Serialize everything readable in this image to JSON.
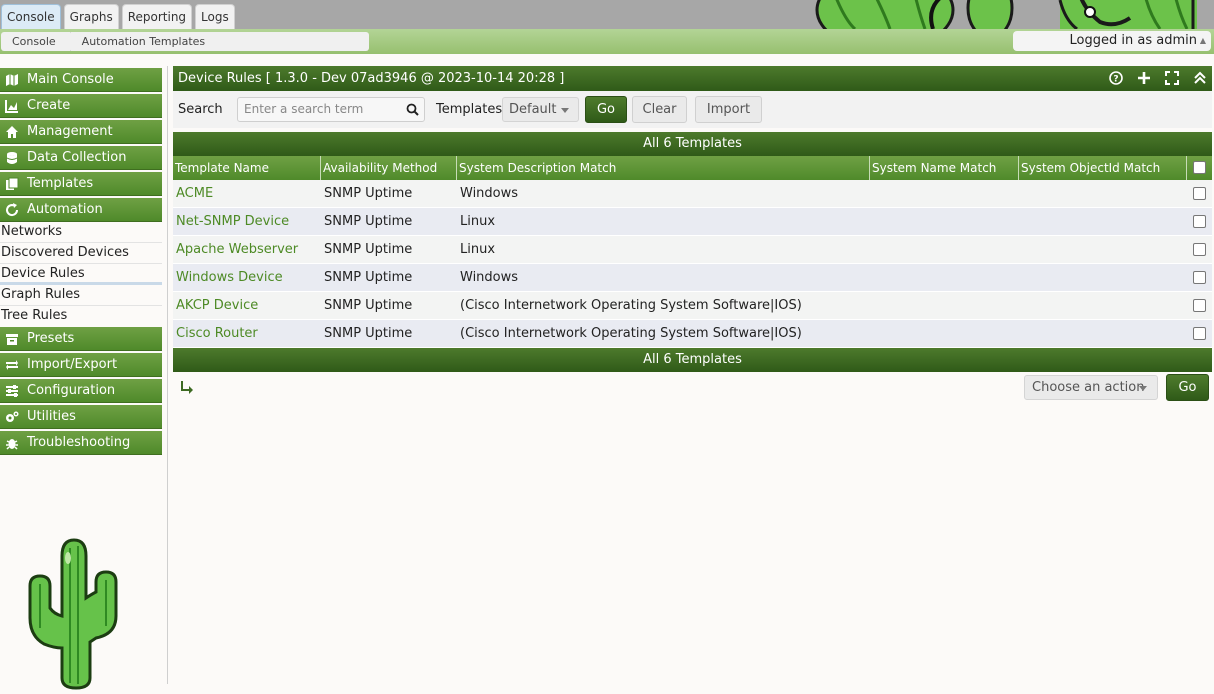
{
  "top_tabs": [
    {
      "label": "Console",
      "active": true
    },
    {
      "label": "Graphs",
      "active": false
    },
    {
      "label": "Reporting",
      "active": false
    },
    {
      "label": "Logs",
      "active": false
    }
  ],
  "breadcrumb": [
    "Console",
    "Automation Templates"
  ],
  "user": {
    "label": "Logged in as admin"
  },
  "sidebar": {
    "heads_top": [
      {
        "label": "Main Console",
        "icon": "map-icon"
      },
      {
        "label": "Create",
        "icon": "chart-icon"
      },
      {
        "label": "Management",
        "icon": "home-icon"
      },
      {
        "label": "Data Collection",
        "icon": "database-icon"
      },
      {
        "label": "Templates",
        "icon": "copy-icon"
      },
      {
        "label": "Automation",
        "icon": "refresh-icon"
      }
    ],
    "automation_items": [
      {
        "label": "Networks",
        "selected": false
      },
      {
        "label": "Discovered Devices",
        "selected": false
      },
      {
        "label": "Device Rules",
        "selected": true
      },
      {
        "label": "Graph Rules",
        "selected": false
      },
      {
        "label": "Tree Rules",
        "selected": false
      }
    ],
    "heads_bottom": [
      {
        "label": "Presets",
        "icon": "archive-icon"
      },
      {
        "label": "Import/Export",
        "icon": "exchange-icon"
      },
      {
        "label": "Configuration",
        "icon": "sliders-icon"
      },
      {
        "label": "Utilities",
        "icon": "cogs-icon"
      },
      {
        "label": "Troubleshooting",
        "icon": "bug-icon"
      }
    ]
  },
  "panel": {
    "title": "Device Rules [ 1.3.0 - Dev 07ad3946 @ 2023-10-14 20:28 ]"
  },
  "filter": {
    "search_label": "Search",
    "search_placeholder": "Enter a search term",
    "templates_label": "Templates",
    "templates_value": "Default",
    "go": "Go",
    "clear": "Clear",
    "import": "Import"
  },
  "table": {
    "caption": "All 6 Templates",
    "columns": [
      "Template Name",
      "Availability Method",
      "System Description Match",
      "System Name Match",
      "System ObjectId Match"
    ],
    "rows": [
      {
        "name": "ACME",
        "method": "SNMP Uptime",
        "desc": "Windows",
        "sysname": "",
        "oid": ""
      },
      {
        "name": "Net-SNMP Device",
        "method": "SNMP Uptime",
        "desc": "Linux",
        "sysname": "",
        "oid": ""
      },
      {
        "name": "Apache Webserver",
        "method": "SNMP Uptime",
        "desc": "Linux",
        "sysname": "",
        "oid": ""
      },
      {
        "name": "Windows Device",
        "method": "SNMP Uptime",
        "desc": "Windows",
        "sysname": "",
        "oid": ""
      },
      {
        "name": "AKCP Device",
        "method": "SNMP Uptime",
        "desc": "(Cisco Internetwork Operating System Software|IOS)",
        "sysname": "",
        "oid": ""
      },
      {
        "name": "Cisco Router",
        "method": "SNMP Uptime",
        "desc": "(Cisco Internetwork Operating System Software|IOS)",
        "sysname": "",
        "oid": ""
      }
    ]
  },
  "actions": {
    "select_label": "Choose an action",
    "go": "Go"
  },
  "colors": {
    "header_green": "#3d6a22",
    "menu_green": "#5e9637",
    "link_green": "#4d8a25"
  }
}
